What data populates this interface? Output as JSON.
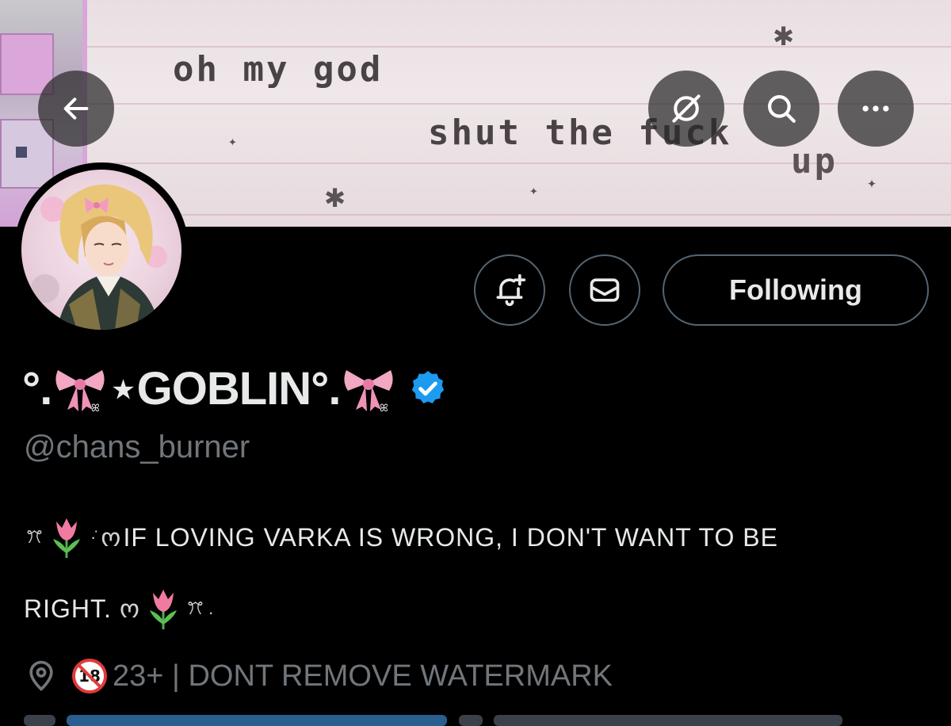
{
  "banner": {
    "text_line1": "oh my god",
    "text_line2": "shut the fuck",
    "text_line3": "up",
    "sparkle": "∗"
  },
  "toolbar": {
    "back_icon": "arrow-left-icon",
    "grok_icon": "grok-icon",
    "search_icon": "search-icon",
    "more_icon": "more-horizontal-icon"
  },
  "actions": {
    "notify_icon": "bell-plus-icon",
    "message_icon": "envelope-icon",
    "following_label": "Following"
  },
  "profile": {
    "name_prefix": "°.",
    "name_middle": "⋆GOBLIN°.",
    "verified": true,
    "handle": "@chans_burner",
    "bio_line1_lead": "ꔫ",
    "bio_line1_ribbon": "ო",
    "bio_line1_text": "IF LOVING VARKA IS WRONG, I DON'T WANT TO BE",
    "bio_line2_text": "RIGHT.",
    "bio_line2_ribbon": "ო",
    "bio_line2_trail": "ꔫ .",
    "location_icon": "location-pin-icon",
    "location_text": "23+ | DONT REMOVE WATERMARK",
    "no_under_18_icon": "no-under-18-icon"
  },
  "colors": {
    "background": "#000000",
    "text": "#e7e9ea",
    "muted": "#71767b",
    "border": "#536471",
    "verified": "#1d9bf0",
    "bow_pink": "#f2a7c3"
  }
}
